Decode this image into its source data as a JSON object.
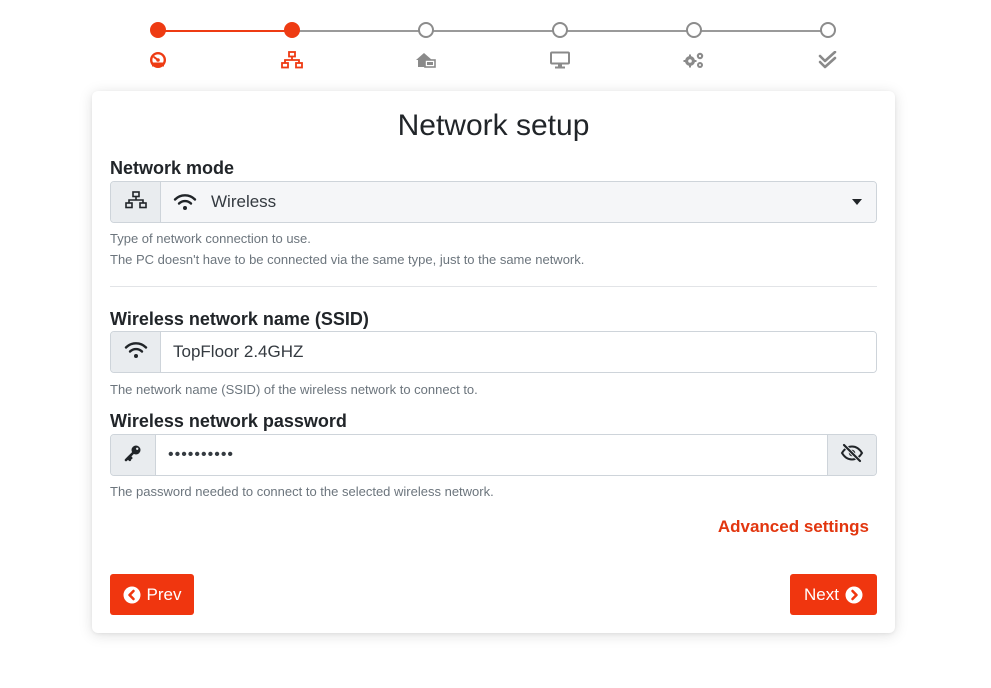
{
  "stepper": {
    "steps": [
      {
        "icon": "dashboard-gauge-icon",
        "state": "done"
      },
      {
        "icon": "network-icon",
        "state": "done"
      },
      {
        "icon": "house-network-icon",
        "state": "todo"
      },
      {
        "icon": "monitor-icon",
        "state": "todo"
      },
      {
        "icon": "gears-icon",
        "state": "todo"
      },
      {
        "icon": "double-check-icon",
        "state": "todo"
      }
    ],
    "colors": {
      "done": "#ee3b13",
      "todo": "#8c8c8c"
    }
  },
  "card": {
    "title": "Network setup",
    "network_mode": {
      "label": "Network mode",
      "value": "Wireless",
      "help_line1": "Type of network connection to use.",
      "help_line2": "The PC doesn't have to be connected via the same type, just to the same network."
    },
    "ssid": {
      "label": "Wireless network name (SSID)",
      "value": "TopFloor 2.4GHZ",
      "help": "The network name (SSID) of the wireless network to connect to."
    },
    "password": {
      "label": "Wireless network password",
      "masked_value": "••••••••••",
      "help": "The password needed to connect to the selected wireless network."
    },
    "advanced_link": "Advanced settings",
    "prev_label": "Prev",
    "next_label": "Next"
  },
  "theme": {
    "accent": "#f0360f"
  }
}
